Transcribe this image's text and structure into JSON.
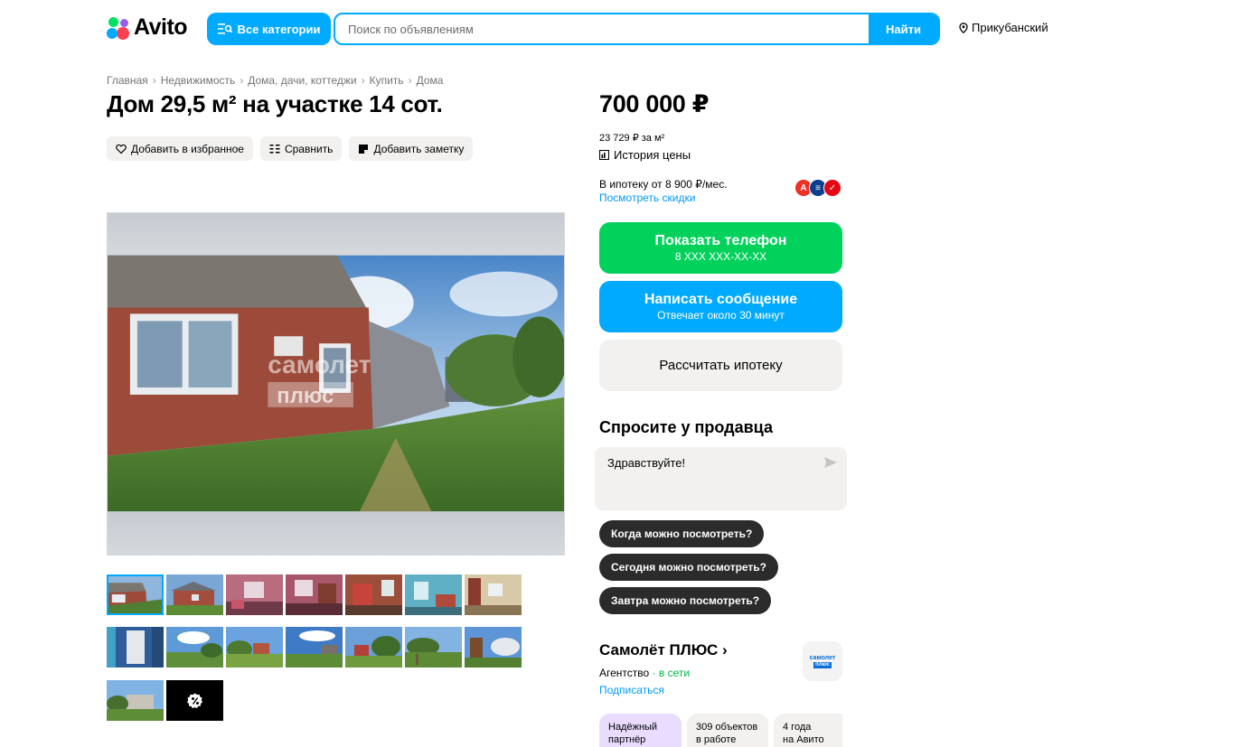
{
  "header": {
    "logo_text": "Avito",
    "categories_label": "Все категории",
    "search_placeholder": "Поиск по объявлениям",
    "search_button": "Найти",
    "location": "Прикубанский"
  },
  "breadcrumbs": [
    "Главная",
    "Недвижимость",
    "Дома, дачи, коттеджи",
    "Купить",
    "Дома"
  ],
  "listing": {
    "title": "Дом 29,5 м² на участке 14 сот.",
    "actions": {
      "favorite": "Добавить в избранное",
      "compare": "Сравнить",
      "note": "Добавить заметку"
    },
    "photo_watermark": [
      "самолет",
      "плюс"
    ],
    "thumbnail_count": 16
  },
  "pricing": {
    "price": "700 000 ₽",
    "price_per_m2": "23 729 ₽ за м²",
    "history_label": "История цены",
    "mortgage_text": "В ипотеку от 8 900 ₽/мес.",
    "discounts_link": "Посмотреть скидки",
    "bank_colors": [
      "#ef3124",
      "#0b3e8c",
      "#e30613"
    ]
  },
  "buttons": {
    "phone_label": "Показать телефон",
    "phone_sub": "8 XXX XXX-XX-XX",
    "message_label": "Написать сообщение",
    "message_sub": "Отвечает около 30 минут",
    "mortgage_calc": "Рассчитать ипотеку"
  },
  "ask": {
    "title": "Спросите у продавца",
    "message_value": "Здравствуйте!",
    "quick_questions": [
      "Когда можно посмотреть?",
      "Сегодня можно посмотреть?",
      "Завтра можно посмотреть?"
    ]
  },
  "seller": {
    "name": "Самолёт ПЛЮС ›",
    "type": "Агентство",
    "status": "· в сети",
    "subscribe": "Подписаться",
    "logo_line1": "самолет",
    "logo_line2": "плюс",
    "badges": [
      {
        "line1": "Надёжный",
        "line2": "партнёр"
      },
      {
        "line1": "309 объектов",
        "line2": "в работе"
      },
      {
        "line1": "4 года",
        "line2": "на Авито"
      }
    ]
  },
  "colors": {
    "accent_blue": "#00aaff",
    "phone_green": "#02d15c",
    "chip_dark": "#2b2b2b"
  }
}
